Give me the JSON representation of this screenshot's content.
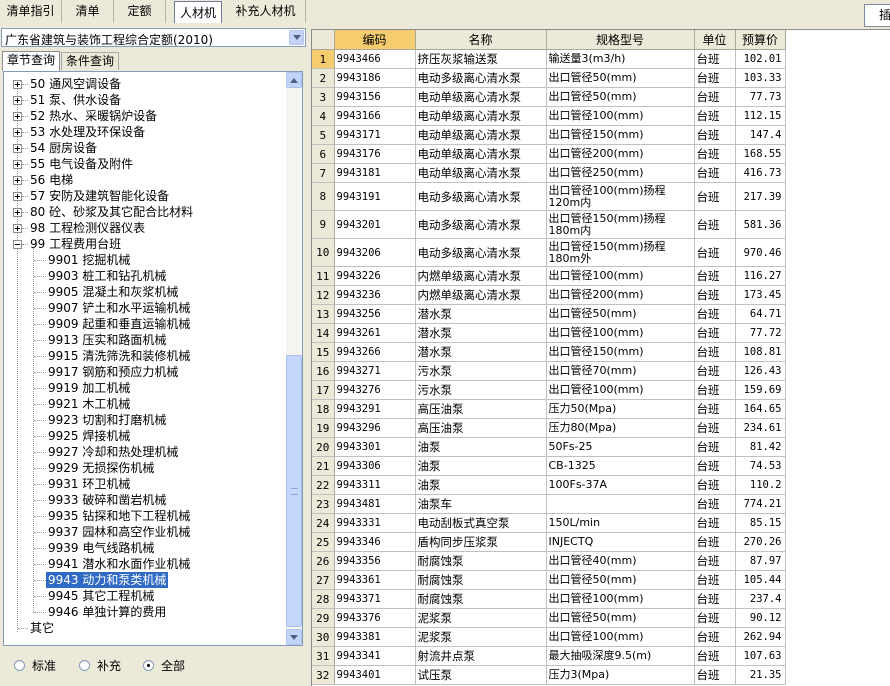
{
  "toolbar": {
    "tabs": [
      {
        "label": "清单指引"
      },
      {
        "label": "清单"
      },
      {
        "label": "定额"
      },
      {
        "label": "人材机"
      },
      {
        "label": "补充人材机"
      }
    ],
    "right_button": "插"
  },
  "library_select": {
    "value": "广东省建筑与装饰工程综合定额(2010)"
  },
  "left_tabs": [
    {
      "label": "章节查询"
    },
    {
      "label": "条件查询"
    }
  ],
  "tree": {
    "top": [
      {
        "code": "50",
        "label": "通风空调设备"
      },
      {
        "code": "51",
        "label": "泵、供水设备"
      },
      {
        "code": "52",
        "label": "热水、采暖锅炉设备"
      },
      {
        "code": "53",
        "label": "水处理及环保设备"
      },
      {
        "code": "54",
        "label": "厨房设备"
      },
      {
        "code": "55",
        "label": "电气设备及附件"
      },
      {
        "code": "56",
        "label": "电梯"
      },
      {
        "code": "57",
        "label": "安防及建筑智能化设备"
      },
      {
        "code": "80",
        "label": "砼、砂浆及其它配合比材料"
      },
      {
        "code": "98",
        "label": "工程检测仪器仪表"
      },
      {
        "code": "99",
        "label": "工程费用台班"
      }
    ],
    "children": [
      {
        "code": "9901",
        "label": "挖掘机械"
      },
      {
        "code": "9903",
        "label": "桩工和钻孔机械"
      },
      {
        "code": "9905",
        "label": "混凝土和灰浆机械"
      },
      {
        "code": "9907",
        "label": "铲土和水平运输机械"
      },
      {
        "code": "9909",
        "label": "起重和垂直运输机械"
      },
      {
        "code": "9913",
        "label": "压实和路面机械"
      },
      {
        "code": "9915",
        "label": "清洗筛洗和装修机械"
      },
      {
        "code": "9917",
        "label": "钢筋和预应力机械"
      },
      {
        "code": "9919",
        "label": "加工机械"
      },
      {
        "code": "9921",
        "label": "木工机械"
      },
      {
        "code": "9923",
        "label": "切割和打磨机械"
      },
      {
        "code": "9925",
        "label": "焊接机械"
      },
      {
        "code": "9927",
        "label": "冷却和热处理机械"
      },
      {
        "code": "9929",
        "label": "无损探伤机械"
      },
      {
        "code": "9931",
        "label": "环卫机械"
      },
      {
        "code": "9933",
        "label": "破碎和凿岩机械"
      },
      {
        "code": "9935",
        "label": "钻探和地下工程机械"
      },
      {
        "code": "9937",
        "label": "园林和高空作业机械"
      },
      {
        "code": "9939",
        "label": "电气线路机械"
      },
      {
        "code": "9941",
        "label": "潜水和水面作业机械"
      },
      {
        "code": "9943",
        "label": "动力和泵类机械"
      },
      {
        "code": "9945",
        "label": "其它工程机械"
      },
      {
        "code": "9946",
        "label": "单独计算的费用"
      }
    ],
    "other": "其它",
    "selected": "9943"
  },
  "filter": {
    "options": [
      {
        "label": "标准"
      },
      {
        "label": "补充"
      },
      {
        "label": "全部"
      }
    ],
    "selected": "全部"
  },
  "table": {
    "headers": {
      "code": "编码",
      "name": "名称",
      "spec": "规格型号",
      "unit": "单位",
      "price": "预算价"
    },
    "rows": [
      {
        "no": "1",
        "code": "9943466",
        "name": "挤压灰浆输送泵",
        "spec": "输送量3(m3/h)",
        "unit": "台班",
        "price": "102.01"
      },
      {
        "no": "2",
        "code": "9943186",
        "name": "电动多级离心清水泵",
        "spec": "出口管径50(mm)",
        "unit": "台班",
        "price": "103.33"
      },
      {
        "no": "3",
        "code": "9943156",
        "name": "电动单级离心清水泵",
        "spec": "出口管径50(mm)",
        "unit": "台班",
        "price": "77.73"
      },
      {
        "no": "4",
        "code": "9943166",
        "name": "电动单级离心清水泵",
        "spec": "出口管径100(mm)",
        "unit": "台班",
        "price": "112.15"
      },
      {
        "no": "5",
        "code": "9943171",
        "name": "电动单级离心清水泵",
        "spec": "出口管径150(mm)",
        "unit": "台班",
        "price": "147.4"
      },
      {
        "no": "6",
        "code": "9943176",
        "name": "电动单级离心清水泵",
        "spec": "出口管径200(mm)",
        "unit": "台班",
        "price": "168.55"
      },
      {
        "no": "7",
        "code": "9943181",
        "name": "电动单级离心清水泵",
        "spec": "出口管径250(mm)",
        "unit": "台班",
        "price": "416.73"
      },
      {
        "no": "8",
        "code": "9943191",
        "name": "电动多级离心清水泵",
        "spec": "出口管径100(mm)扬程120m内",
        "unit": "台班",
        "price": "217.39"
      },
      {
        "no": "9",
        "code": "9943201",
        "name": "电动多级离心清水泵",
        "spec": "出口管径150(mm)扬程180m内",
        "unit": "台班",
        "price": "581.36"
      },
      {
        "no": "10",
        "code": "9943206",
        "name": "电动多级离心清水泵",
        "spec": "出口管径150(mm)扬程180m外",
        "unit": "台班",
        "price": "970.46"
      },
      {
        "no": "11",
        "code": "9943226",
        "name": "内燃单级离心清水泵",
        "spec": "出口管径100(mm)",
        "unit": "台班",
        "price": "116.27"
      },
      {
        "no": "12",
        "code": "9943236",
        "name": "内燃单级离心清水泵",
        "spec": "出口管径200(mm)",
        "unit": "台班",
        "price": "173.45"
      },
      {
        "no": "13",
        "code": "9943256",
        "name": "潜水泵",
        "spec": "出口管径50(mm)",
        "unit": "台班",
        "price": "64.71"
      },
      {
        "no": "14",
        "code": "9943261",
        "name": "潜水泵",
        "spec": "出口管径100(mm)",
        "unit": "台班",
        "price": "77.72"
      },
      {
        "no": "15",
        "code": "9943266",
        "name": "潜水泵",
        "spec": "出口管径150(mm)",
        "unit": "台班",
        "price": "108.81"
      },
      {
        "no": "16",
        "code": "9943271",
        "name": "污水泵",
        "spec": "出口管径70(mm)",
        "unit": "台班",
        "price": "126.43"
      },
      {
        "no": "17",
        "code": "9943276",
        "name": "污水泵",
        "spec": "出口管径100(mm)",
        "unit": "台班",
        "price": "159.69"
      },
      {
        "no": "18",
        "code": "9943291",
        "name": "高压油泵",
        "spec": "压力50(Mpa)",
        "unit": "台班",
        "price": "164.65"
      },
      {
        "no": "19",
        "code": "9943296",
        "name": "高压油泵",
        "spec": "压力80(Mpa)",
        "unit": "台班",
        "price": "234.61"
      },
      {
        "no": "20",
        "code": "9943301",
        "name": "油泵",
        "spec": "50Fs-25",
        "unit": "台班",
        "price": "81.42"
      },
      {
        "no": "21",
        "code": "9943306",
        "name": "油泵",
        "spec": "CB-1325",
        "unit": "台班",
        "price": "74.53"
      },
      {
        "no": "22",
        "code": "9943311",
        "name": "油泵",
        "spec": "100Fs-37A",
        "unit": "台班",
        "price": "110.2"
      },
      {
        "no": "23",
        "code": "9943481",
        "name": "油泵车",
        "spec": "",
        "unit": "台班",
        "price": "774.21"
      },
      {
        "no": "24",
        "code": "9943331",
        "name": "电动刮板式真空泵",
        "spec": "150L/min",
        "unit": "台班",
        "price": "85.15"
      },
      {
        "no": "25",
        "code": "9943346",
        "name": "盾构同步压浆泵",
        "spec": "INJECTQ",
        "unit": "台班",
        "price": "270.26"
      },
      {
        "no": "26",
        "code": "9943356",
        "name": "耐腐蚀泵",
        "spec": "出口管径40(mm)",
        "unit": "台班",
        "price": "87.97"
      },
      {
        "no": "27",
        "code": "9943361",
        "name": "耐腐蚀泵",
        "spec": "出口管径50(mm)",
        "unit": "台班",
        "price": "105.44"
      },
      {
        "no": "28",
        "code": "9943371",
        "name": "耐腐蚀泵",
        "spec": "出口管径100(mm)",
        "unit": "台班",
        "price": "237.4"
      },
      {
        "no": "29",
        "code": "9943376",
        "name": "泥浆泵",
        "spec": "出口管径50(mm)",
        "unit": "台班",
        "price": "90.12"
      },
      {
        "no": "30",
        "code": "9943381",
        "name": "泥浆泵",
        "spec": "出口管径100(mm)",
        "unit": "台班",
        "price": "262.94"
      },
      {
        "no": "31",
        "code": "9943341",
        "name": "射流井点泵",
        "spec": "最大抽吸深度9.5(m)",
        "unit": "台班",
        "price": "107.63"
      },
      {
        "no": "32",
        "code": "9943401",
        "name": "试压泵",
        "spec": "压力3(Mpa)",
        "unit": "台班",
        "price": "21.35"
      }
    ]
  }
}
